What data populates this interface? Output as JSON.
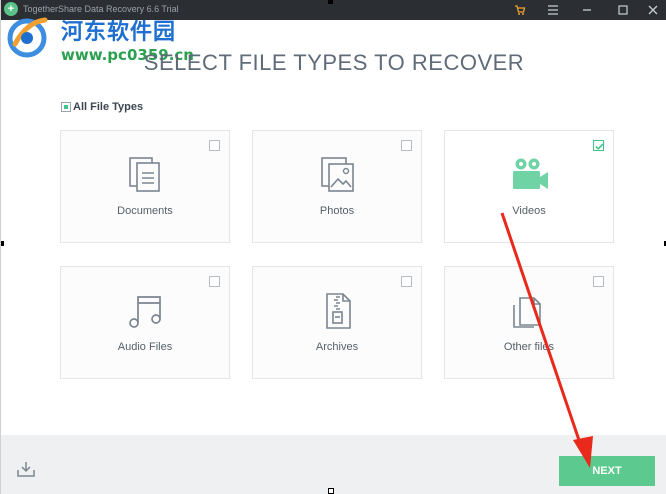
{
  "titlebar": {
    "title": "TogetherShare Data Recovery 6.6 Trial",
    "app_icon": "+",
    "icons": [
      "cart-icon",
      "menu-icon",
      "minimize-icon",
      "maximize-icon",
      "close-icon"
    ]
  },
  "watermark": {
    "text_cn": "河东软件园",
    "url": "www.pc0359.cn"
  },
  "heading": "SELECT FILE TYPES TO RECOVER",
  "all_file_types": {
    "label": "All File Types",
    "state": "partial"
  },
  "file_types": [
    {
      "label": "Documents",
      "icon": "documents-icon",
      "checked": false
    },
    {
      "label": "Photos",
      "icon": "photos-icon",
      "checked": false
    },
    {
      "label": "Videos",
      "icon": "video-camera-icon",
      "checked": true
    },
    {
      "label": "Audio Files",
      "icon": "music-note-icon",
      "checked": false
    },
    {
      "label": "Archives",
      "icon": "archive-icon",
      "checked": false
    },
    {
      "label": "Other files",
      "icon": "other-files-icon",
      "checked": false
    }
  ],
  "footer": {
    "export_icon": "download-icon",
    "next_label": "NEXT"
  },
  "colors": {
    "accent": "#5cc98e",
    "titlebar": "#2b2f33",
    "annotation_arrow": "#e8291c"
  }
}
